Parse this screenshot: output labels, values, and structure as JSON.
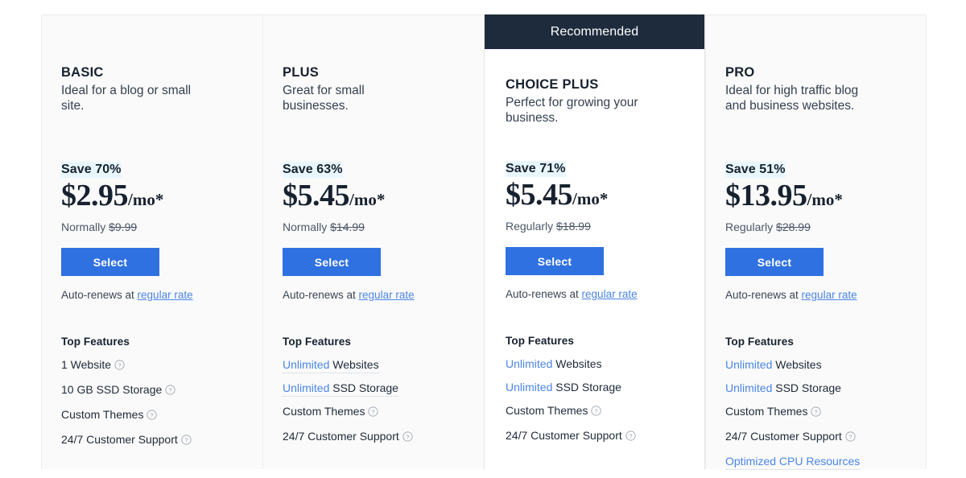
{
  "ribbon": {
    "label": "Recommended"
  },
  "links": {
    "autorenew_prefix": "Auto-renews at ",
    "autorenew_link": "regular rate"
  },
  "features_heading": "Top Features",
  "select_label": "Select",
  "plans": [
    {
      "id": "basic",
      "name": "BASIC",
      "description": "Ideal for a blog or small site.",
      "save": "Save 70%",
      "price": "$2.95",
      "period": "/mo*",
      "normally_prefix": "Normally ",
      "normally_price": "$9.99",
      "select_label": "Select",
      "autorenew_prefix": "Auto-renews at ",
      "autorenew_link": "regular rate",
      "features_heading": "Top Features",
      "features": [
        {
          "highlight": "",
          "text": "1 Website",
          "info": true,
          "dotted": false
        },
        {
          "highlight": "",
          "text": "10 GB SSD Storage",
          "info": true,
          "dotted": false
        },
        {
          "highlight": "",
          "text": "Custom Themes",
          "info": true,
          "dotted": false
        },
        {
          "highlight": "",
          "text": "24/7 Customer Support",
          "info": true,
          "dotted": false
        }
      ]
    },
    {
      "id": "plus",
      "name": "PLUS",
      "description": "Great for small businesses.",
      "save": "Save 63%",
      "price": "$5.45",
      "period": "/mo*",
      "normally_prefix": "Normally ",
      "normally_price": "$14.99",
      "select_label": "Select",
      "autorenew_prefix": "Auto-renews at ",
      "autorenew_link": "regular rate",
      "features_heading": "Top Features",
      "features": [
        {
          "highlight": "Unlimited",
          "text": " Websites",
          "info": false,
          "dotted": true
        },
        {
          "highlight": "Unlimited",
          "text": " SSD Storage",
          "info": false,
          "dotted": true
        },
        {
          "highlight": "",
          "text": "Custom Themes",
          "info": true,
          "dotted": false
        },
        {
          "highlight": "",
          "text": "24/7 Customer Support",
          "info": true,
          "dotted": false
        }
      ]
    },
    {
      "id": "choice-plus",
      "name": "CHOICE PLUS",
      "description": "Perfect for growing your business.",
      "save": "Save 71%",
      "price": "$5.45",
      "period": "/mo*",
      "normally_prefix": "Regularly ",
      "normally_price": "$18.99",
      "select_label": "Select",
      "autorenew_prefix": "Auto-renews at ",
      "autorenew_link": "regular rate",
      "features_heading": "Top Features",
      "features": [
        {
          "highlight": "Unlimited",
          "text": " Websites",
          "info": false,
          "dotted": false
        },
        {
          "highlight": "Unlimited",
          "text": " SSD Storage",
          "info": false,
          "dotted": false
        },
        {
          "highlight": "",
          "text": "Custom Themes",
          "info": true,
          "dotted": false
        },
        {
          "highlight": "",
          "text": "24/7 Customer Support",
          "info": true,
          "dotted": false
        }
      ]
    },
    {
      "id": "pro",
      "name": "PRO",
      "description": "Ideal for high traffic blog and business websites.",
      "save": "Save 51%",
      "price": "$13.95",
      "period": "/mo*",
      "normally_prefix": "Regularly ",
      "normally_price": "$28.99",
      "select_label": "Select",
      "autorenew_prefix": "Auto-renews at ",
      "autorenew_link": "regular rate",
      "features_heading": "Top Features",
      "features": [
        {
          "highlight": "Unlimited",
          "text": " Websites",
          "info": false,
          "dotted": false
        },
        {
          "highlight": "Unlimited",
          "text": " SSD Storage",
          "info": false,
          "dotted": false
        },
        {
          "highlight": "",
          "text": "Custom Themes",
          "info": true,
          "dotted": false
        },
        {
          "highlight": "",
          "text": "24/7 Customer Support",
          "info": true,
          "dotted": false
        },
        {
          "highlight": "Optimized CPU Resources",
          "text": "",
          "info": false,
          "dotted": true
        }
      ]
    }
  ],
  "colors": {
    "ribbon_bg": "#1e2b3c",
    "button_bg": "#2f71e0",
    "link_blue": "#4a85e8",
    "save_highlight": "#e8f7fd",
    "heading": "#17212f",
    "card_bg": "#fafafa",
    "featured_card_bg": "#ffffff",
    "border": "#ececec"
  }
}
